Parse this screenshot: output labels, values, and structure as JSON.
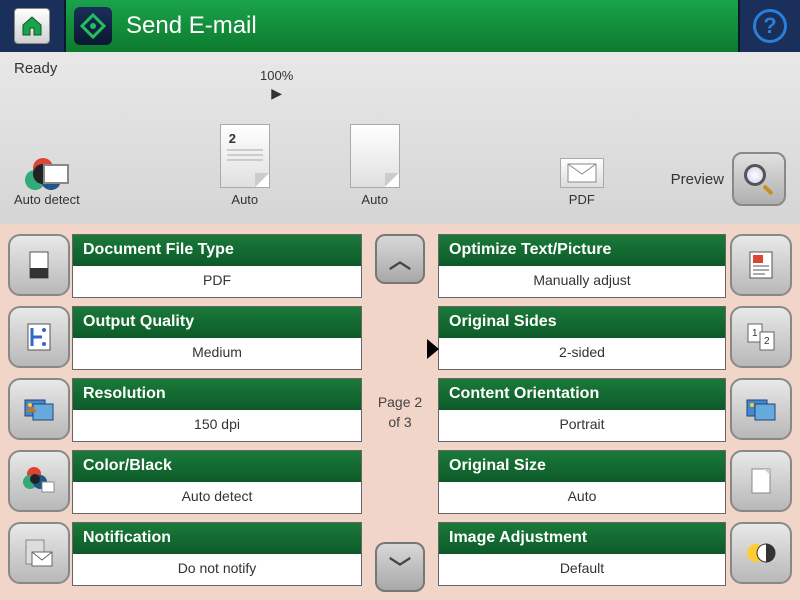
{
  "header": {
    "title": "Send E-mail"
  },
  "status": {
    "text": "Ready",
    "auto_detect_label": "Auto detect",
    "page_number": "2",
    "page_auto_label": "Auto",
    "zoom": "100%",
    "zoom_auto_label": "Auto",
    "pdf_label": "PDF",
    "preview_label": "Preview"
  },
  "pagination": {
    "page_text": "Page 2",
    "of_text": "of 3"
  },
  "left_settings": [
    {
      "title": "Document File Type",
      "value": "PDF",
      "icon": "document-file-icon"
    },
    {
      "title": "Output Quality",
      "value": "Medium",
      "icon": "quality-icon"
    },
    {
      "title": "Resolution",
      "value": "150 dpi",
      "icon": "resolution-icon"
    },
    {
      "title": "Color/Black",
      "value": "Auto detect",
      "icon": "color-black-icon"
    },
    {
      "title": "Notification",
      "value": "Do not notify",
      "icon": "notification-icon"
    }
  ],
  "right_settings": [
    {
      "title": "Optimize Text/Picture",
      "value": "Manually adjust",
      "icon": "optimize-icon"
    },
    {
      "title": "Original Sides",
      "value": "2-sided",
      "icon": "sides-icon"
    },
    {
      "title": "Content Orientation",
      "value": "Portrait",
      "icon": "orientation-icon"
    },
    {
      "title": "Original Size",
      "value": "Auto",
      "icon": "size-icon"
    },
    {
      "title": "Image Adjustment",
      "value": "Default",
      "icon": "image-adjust-icon"
    }
  ]
}
